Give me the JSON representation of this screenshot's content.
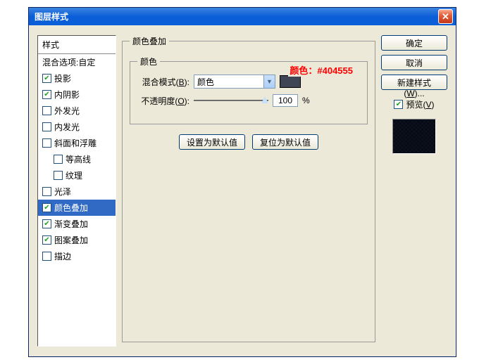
{
  "title": "图层样式",
  "annot": "颜色：#404555",
  "styles": {
    "header": "样式",
    "sub": "混合选项:自定",
    "items": [
      {
        "label": "投影",
        "checked": true,
        "selected": false,
        "indent": false
      },
      {
        "label": "内阴影",
        "checked": true,
        "selected": false,
        "indent": false
      },
      {
        "label": "外发光",
        "checked": false,
        "selected": false,
        "indent": false
      },
      {
        "label": "内发光",
        "checked": false,
        "selected": false,
        "indent": false
      },
      {
        "label": "斜面和浮雕",
        "checked": false,
        "selected": false,
        "indent": false
      },
      {
        "label": "等高线",
        "checked": false,
        "selected": false,
        "indent": true
      },
      {
        "label": "纹理",
        "checked": false,
        "selected": false,
        "indent": true
      },
      {
        "label": "光泽",
        "checked": false,
        "selected": false,
        "indent": false
      },
      {
        "label": "颜色叠加",
        "checked": true,
        "selected": true,
        "indent": false
      },
      {
        "label": "渐变叠加",
        "checked": true,
        "selected": false,
        "indent": false
      },
      {
        "label": "图案叠加",
        "checked": true,
        "selected": false,
        "indent": false
      },
      {
        "label": "描边",
        "checked": false,
        "selected": false,
        "indent": false
      }
    ]
  },
  "group": {
    "outer": "颜色叠加",
    "inner": "颜色",
    "blend_label": "混合模式(B):",
    "blend_value": "颜色",
    "opacity_label": "不透明度(O):",
    "opacity_value": "100",
    "opacity_unit": "%",
    "swatch_color": "#404555",
    "set_default": "设置为默认值",
    "reset_default": "复位为默认值"
  },
  "right": {
    "ok": "确定",
    "cancel": "取消",
    "newstyle": "新建样式(W)...",
    "preview": "预览(V)"
  }
}
